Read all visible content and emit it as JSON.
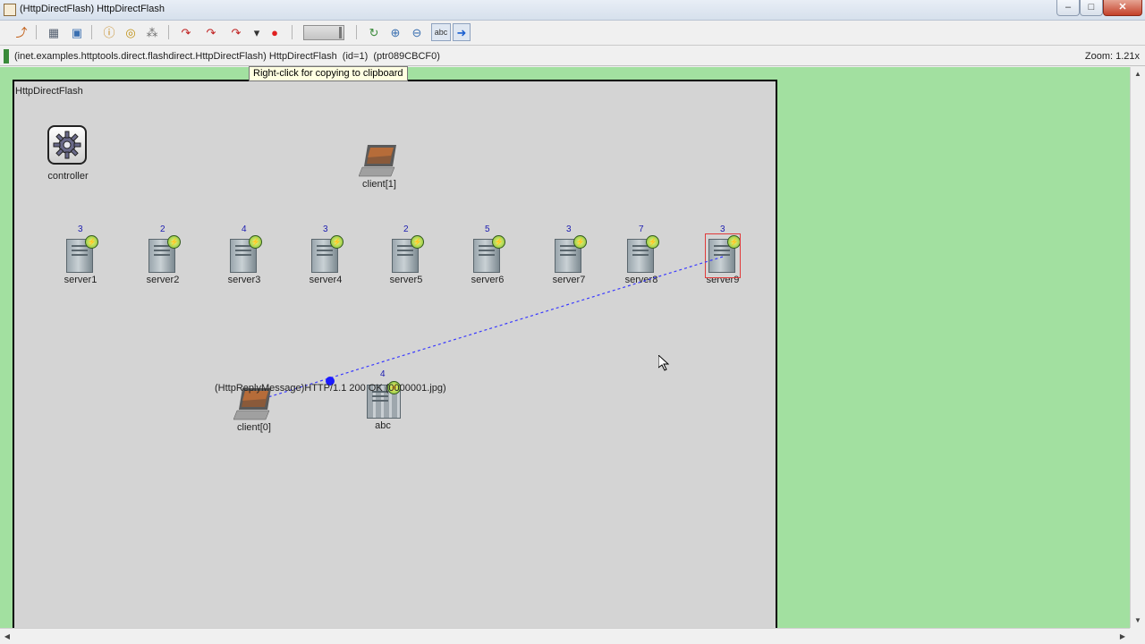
{
  "window": {
    "title": "(HttpDirectFlash) HttpDirectFlash",
    "minimize_label": "–",
    "maximize_label": "□",
    "close_label": "✕"
  },
  "toolbar": {
    "buttons": [
      {
        "name": "go-to-parent-icon",
        "glyph": "⤴",
        "color": "#c05a10"
      },
      {
        "name": "module-output-icon",
        "glyph": "▦",
        "color": "#556070"
      },
      {
        "name": "screen-icon",
        "glyph": "▣",
        "color": "#3a6fb0"
      },
      {
        "name": "inspect-object-icon",
        "glyph": "ⓘ",
        "color": "#c08010"
      },
      {
        "name": "find-objects-icon",
        "glyph": "◎",
        "color": "#c09010"
      },
      {
        "name": "network-icon",
        "glyph": "⁂",
        "color": "#707070"
      },
      {
        "name": "step-icon",
        "glyph": "↷",
        "color": "#c02020"
      },
      {
        "name": "run-icon",
        "glyph": "↷",
        "color": "#c02020"
      },
      {
        "name": "fast-run-icon",
        "glyph": "↷",
        "color": "#c02020"
      },
      {
        "name": "run-until-icon",
        "glyph": "▾",
        "color": "#333333"
      },
      {
        "name": "stop-icon",
        "glyph": "●",
        "color": "#e02020"
      },
      {
        "name": "refresh-layout-icon",
        "glyph": "↻",
        "color": "#3a8a3a"
      },
      {
        "name": "zoom-in-icon",
        "glyph": "⊕",
        "color": "#3a6fb0"
      },
      {
        "name": "zoom-out-icon",
        "glyph": "⊖",
        "color": "#3a6fb0"
      },
      {
        "name": "show-labels-icon",
        "glyph": "abc",
        "color": "#333333"
      },
      {
        "name": "show-arrows-icon",
        "glyph": "➜",
        "color": "#1a5fd0"
      }
    ]
  },
  "infobar": {
    "path": "(inet.examples.httptools.direct.flashdirect.HttpDirectFlash) HttpDirectFlash  (id=1)  (ptr089CBCF0)",
    "zoom": "Zoom: 1.21x"
  },
  "tooltip": "Right-click for copying to clipboard",
  "network": {
    "name": "HttpDirectFlash",
    "controller": {
      "label": "controller"
    },
    "clients": [
      {
        "label": "client[1]"
      },
      {
        "label": "client[0]"
      }
    ],
    "servers": [
      {
        "label": "server1",
        "queue": "3"
      },
      {
        "label": "server2",
        "queue": "2"
      },
      {
        "label": "server3",
        "queue": "4"
      },
      {
        "label": "server4",
        "queue": "3"
      },
      {
        "label": "server5",
        "queue": "2"
      },
      {
        "label": "server6",
        "queue": "5"
      },
      {
        "label": "server7",
        "queue": "3"
      },
      {
        "label": "server8",
        "queue": "7"
      },
      {
        "label": "server9",
        "queue": "3"
      }
    ],
    "rack": {
      "label": "abc",
      "queue": "4"
    },
    "message": "(HttpReplyMessage)HTTP/1.1 200 OK (0000001.jpg)"
  },
  "colors": {
    "canvas_bg": "#a2e0a0",
    "network_bg": "#d4d4d4",
    "message_line": "#3a3aff",
    "queue_text": "#1a1ab0",
    "selection": "#e03a3a"
  }
}
